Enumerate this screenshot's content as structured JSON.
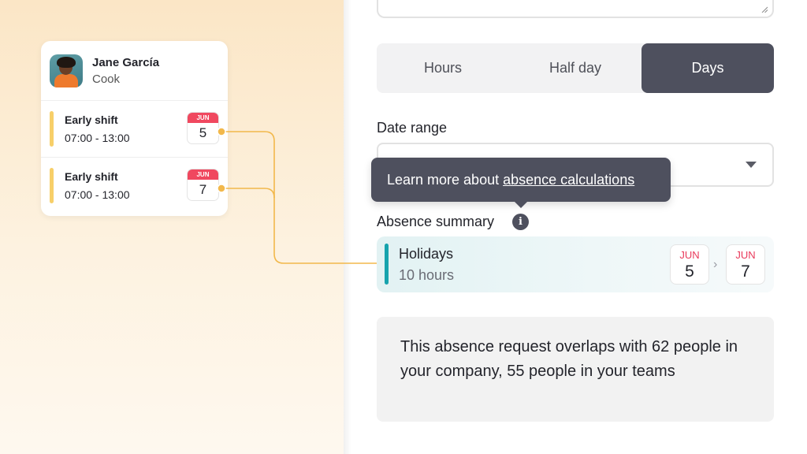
{
  "employee": {
    "name": "Jane García",
    "role": "Cook",
    "shifts": [
      {
        "title": "Early shift",
        "time": "07:00 - 13:00",
        "month": "JUN",
        "day": "5"
      },
      {
        "title": "Early shift",
        "time": "07:00 - 13:00",
        "month": "JUN",
        "day": "7"
      }
    ]
  },
  "segmented": {
    "options": [
      "Hours",
      "Half day",
      "Days"
    ],
    "selected": "Days"
  },
  "date_range": {
    "label": "Date range"
  },
  "tooltip": {
    "text": "Learn more about",
    "link": "absence calculations"
  },
  "summary": {
    "label": "Absence summary",
    "info_icon": "info-icon",
    "type": "Holidays",
    "amount": "10 hours",
    "start": {
      "month": "JUN",
      "day": "5"
    },
    "end": {
      "month": "JUN",
      "day": "7"
    },
    "separator": "›"
  },
  "overlap": {
    "message": "This absence request overlaps with 62 people in your company, 55 people in your teams"
  },
  "colors": {
    "shift_accent": "#f7cf69",
    "holiday_accent": "#16a3ad",
    "calendar_red": "#f0485f",
    "segment_active": "#4e505e",
    "connector": "#f2b84b"
  }
}
